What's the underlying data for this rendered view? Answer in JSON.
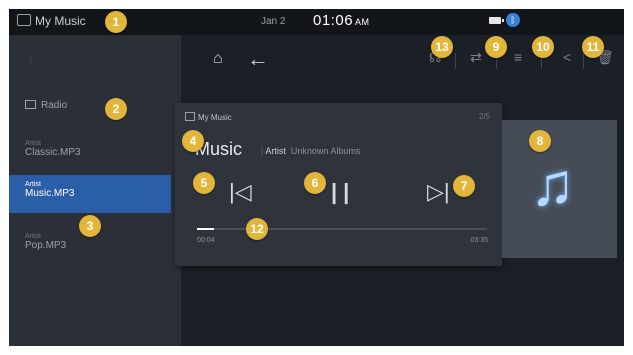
{
  "status_bar": {
    "source": "My Music",
    "date": "Jan 2",
    "time": "01:06",
    "ampm": "AM"
  },
  "sidebar": {
    "radio": "Radio",
    "items": [
      {
        "sub": "Artist",
        "label": "Classic.MP3"
      },
      {
        "sub": "Artist",
        "label": "Music.MP3"
      },
      {
        "sub": "Artist",
        "label": "Pop.MP3"
      }
    ]
  },
  "player": {
    "source": "My Music",
    "track_index": "2/5",
    "title": "Music",
    "artist": "Artist",
    "album": "Unknown Albums",
    "elapsed": "00:04",
    "duration": "03:35",
    "progress": 0.06
  },
  "callouts": [
    "1",
    "2",
    "3",
    "4",
    "5",
    "6",
    "7",
    "8",
    "9",
    "10",
    "11",
    "12",
    "13"
  ],
  "colors": {
    "badge": "#e3b53a",
    "selected": "#2a5fa8",
    "accent_note": "#b6d9ff"
  }
}
